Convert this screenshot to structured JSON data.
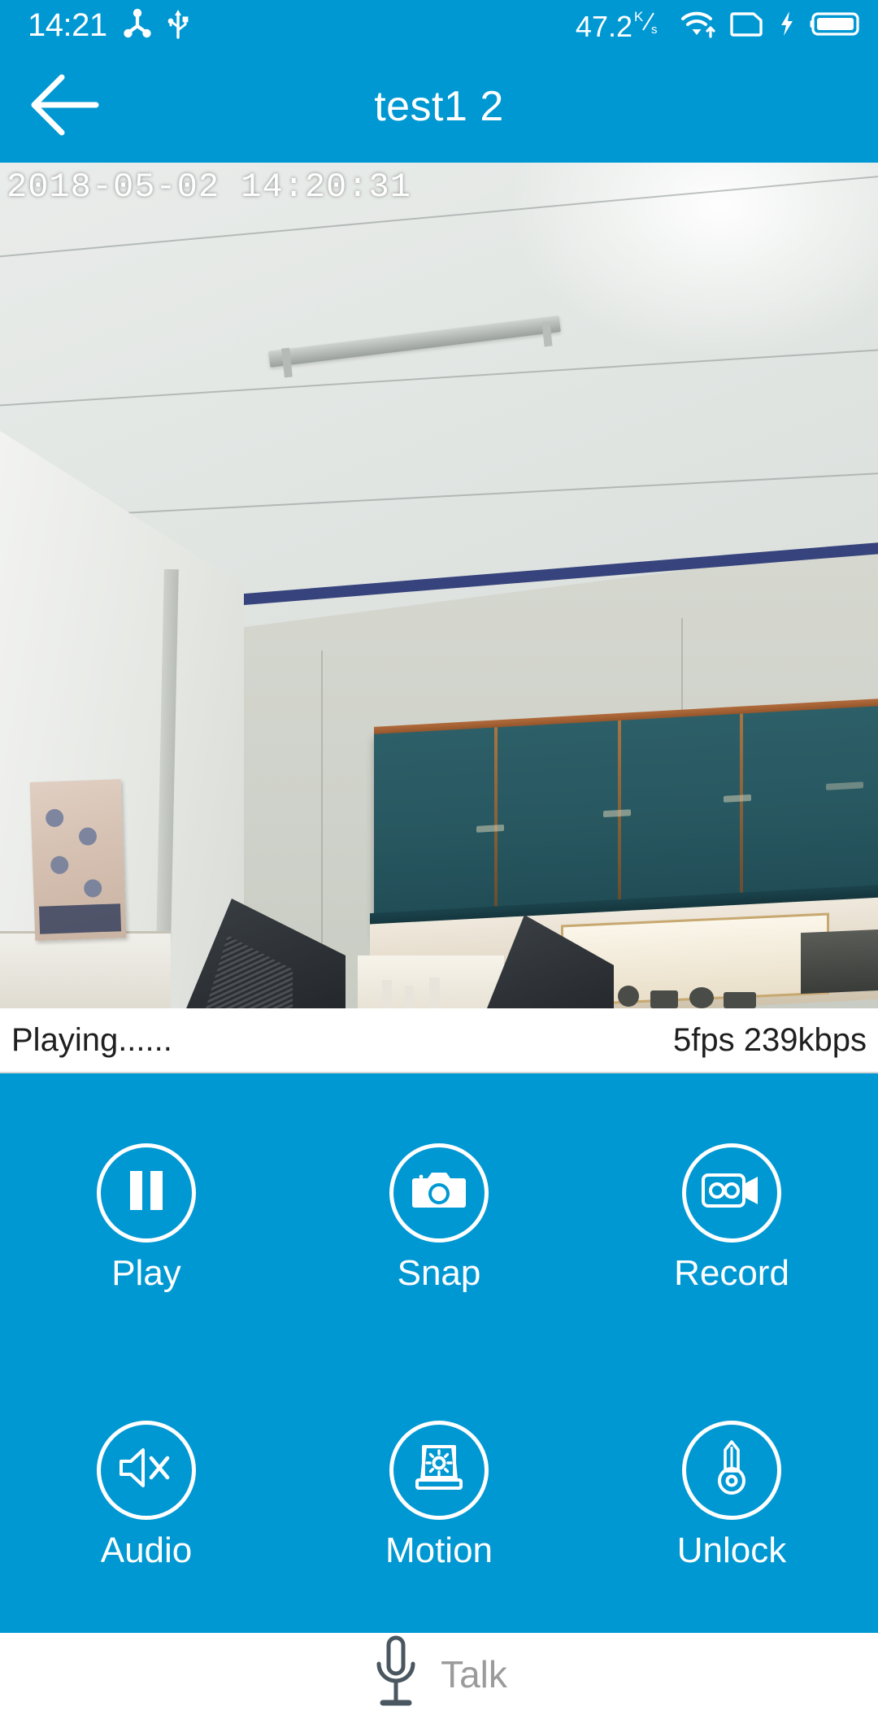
{
  "theme": {
    "accent": "#0098d3",
    "panel_bg": "#ffffff",
    "text_on_accent": "#ffffff",
    "info_text": "#1f1f1f",
    "talk_label": "#9b9b9b",
    "mic_icon": "#4a5760"
  },
  "status_bar": {
    "clock": "14:21",
    "icons_left": [
      "adb-icon",
      "usb-icon"
    ],
    "net_rate": "47.2",
    "net_rate_unit_top": "K",
    "net_rate_unit_bottom": "s",
    "icons_right": [
      "wifi-icon",
      "sim-card-icon",
      "charging-bolt-icon",
      "battery-icon"
    ]
  },
  "title_bar": {
    "back_icon": "arrow-left-icon",
    "title": "test1 2"
  },
  "video": {
    "timestamp": "2018-05-02 14:20:31"
  },
  "info_bar": {
    "status": "Playing......",
    "stats": "5fps 239kbps"
  },
  "controls": {
    "rows": [
      [
        {
          "label": "Play",
          "icon": "pause-icon"
        },
        {
          "label": "Snap",
          "icon": "camera-icon"
        },
        {
          "label": "Record",
          "icon": "video-camera-icon"
        }
      ],
      [
        {
          "label": "Audio",
          "icon": "speaker-mute-icon"
        },
        {
          "label": "Motion",
          "icon": "alarm-light-icon"
        },
        {
          "label": "Unlock",
          "icon": "key-icon"
        }
      ]
    ]
  },
  "talk_bar": {
    "icon": "microphone-icon",
    "label": "Talk"
  }
}
